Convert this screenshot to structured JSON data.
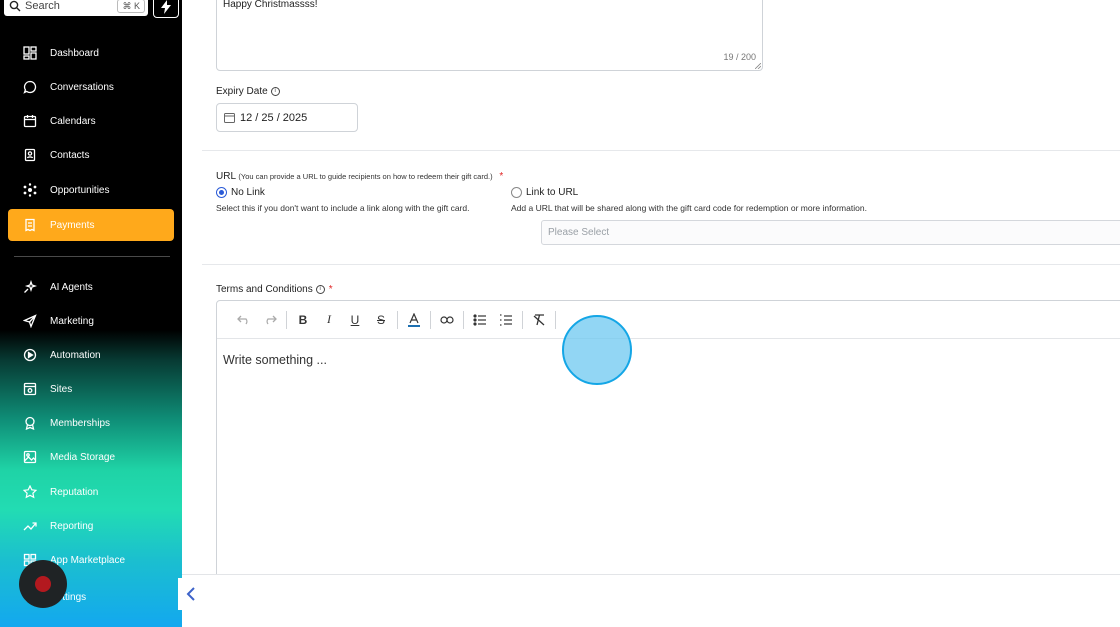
{
  "sidebar": {
    "search": {
      "placeholder": "Search",
      "shortcut": "⌘ K"
    },
    "items_top": [
      {
        "label": "Dashboard",
        "icon": "dashboard-icon"
      },
      {
        "label": "Conversations",
        "icon": "chat-bubble-icon"
      },
      {
        "label": "Calendars",
        "icon": "calendar-icon"
      },
      {
        "label": "Contacts",
        "icon": "contact-book-icon"
      },
      {
        "label": "Opportunities",
        "icon": "opportunities-icon"
      },
      {
        "label": "Payments",
        "icon": "receipt-icon",
        "active": true
      }
    ],
    "items_bottom": [
      {
        "label": "AI Agents",
        "icon": "sparkle-icon"
      },
      {
        "label": "Marketing",
        "icon": "send-icon"
      },
      {
        "label": "Automation",
        "icon": "automation-icon"
      },
      {
        "label": "Sites",
        "icon": "sites-icon"
      },
      {
        "label": "Memberships",
        "icon": "badge-icon"
      },
      {
        "label": "Media Storage",
        "icon": "image-icon"
      },
      {
        "label": "Reputation",
        "icon": "star-icon"
      },
      {
        "label": "Reporting",
        "icon": "trend-icon"
      },
      {
        "label": "App Marketplace",
        "icon": "grid-icon"
      },
      {
        "label": "Settings",
        "icon": "gear-icon"
      }
    ],
    "active_color": "#ffa91b"
  },
  "message": {
    "value": "Happy Christmassss!",
    "counter": "19 / 200"
  },
  "expiry": {
    "label": "Expiry Date",
    "value": "12 / 25 / 2025"
  },
  "url": {
    "label": "URL",
    "hint": "(You can provide a URL to guide recipients on how to redeem their gift card.)",
    "required": "*",
    "options": [
      {
        "label": "No Link",
        "description": "Select this if you don't want to include a link along with the gift card.",
        "selected": true
      },
      {
        "label": "Link to URL",
        "description": "Add a URL that will be shared along with the gift card code for redemption or more information.",
        "selected": false
      }
    ],
    "select_placeholder": "Please Select"
  },
  "terms": {
    "label": "Terms and Conditions",
    "required": "*",
    "editor_placeholder": "Write something ...",
    "toolbar": [
      "undo-icon",
      "redo-icon",
      "bold-icon",
      "italic-icon",
      "underline-icon",
      "strikethrough-icon",
      "text-color-icon",
      "link-icon",
      "bullet-list-icon",
      "numbered-list-icon",
      "clear-format-icon"
    ]
  }
}
